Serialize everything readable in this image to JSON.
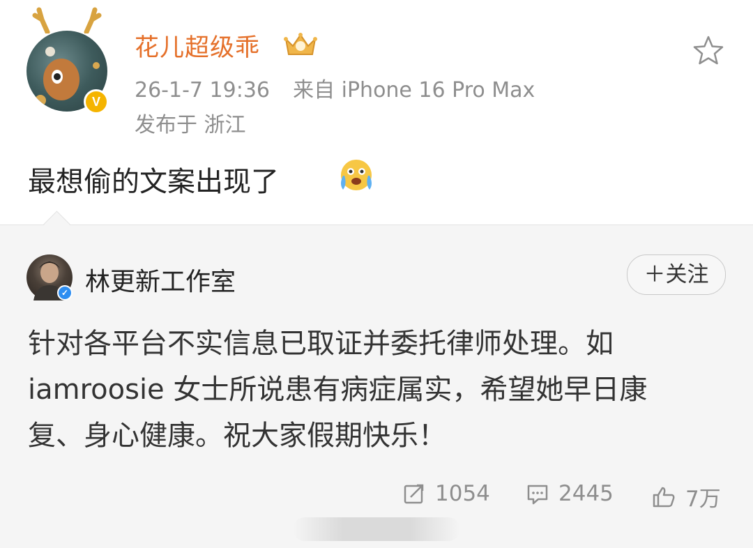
{
  "post": {
    "username": "花儿超级乖",
    "timestamp": "26-1-7 19:36",
    "source": "来自 iPhone 16 Pro Max",
    "location": "发布于 浙江",
    "text": "最想偷的文案出现了",
    "emoji": "crying-face-emoji"
  },
  "repost": {
    "author": "林更新工作室",
    "follow_label": "＋关注",
    "text_lines": [
      "针对各平台不实信息已取证并委托律师处理。如",
      "iamroosie 女士所说患有病症属实，希望她早日康",
      "复、身心健康。祝大家假期快乐！"
    ],
    "reposts": "1054",
    "comments": "2445",
    "likes": "7万"
  },
  "colors": {
    "username": "#e5702a",
    "meta": "#8e8e8e",
    "repost_bg": "#f5f5f5",
    "verified_gold": "#f5b400",
    "verified_blue": "#2e8ef1"
  }
}
